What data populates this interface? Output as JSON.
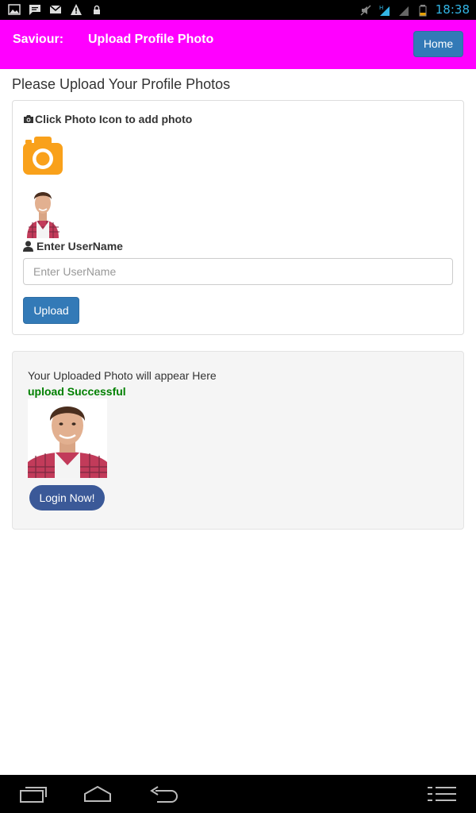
{
  "status_bar": {
    "time": "18:38",
    "icons": [
      "gallery-icon",
      "message-icon",
      "gmail-icon",
      "warning-icon",
      "lock-icon",
      "mute-icon",
      "signal-h-icon",
      "signal-icon",
      "battery-icon"
    ]
  },
  "header": {
    "brand": "Saviour:",
    "title": "Upload Profile Photo",
    "home_label": "Home"
  },
  "intro_text": "Please Upload Your Profile Photos",
  "upload_form": {
    "hint": "Click Photo Icon to add photo",
    "username_label": "Enter UserName",
    "username_placeholder": "Enter UserName",
    "username_value": "",
    "upload_label": "Upload"
  },
  "result": {
    "note": "Your Uploaded Photo will appear Here",
    "status": "upload Successful",
    "login_label": "Login Now!"
  },
  "nav_bar": {
    "buttons": [
      "recent-apps-icon",
      "home-icon",
      "back-icon",
      "menu-icon"
    ]
  },
  "colors": {
    "header": "#ff00ff",
    "primary": "#337ab7",
    "login": "#3b5998",
    "success": "#008000",
    "camera": "#f9a11b"
  }
}
